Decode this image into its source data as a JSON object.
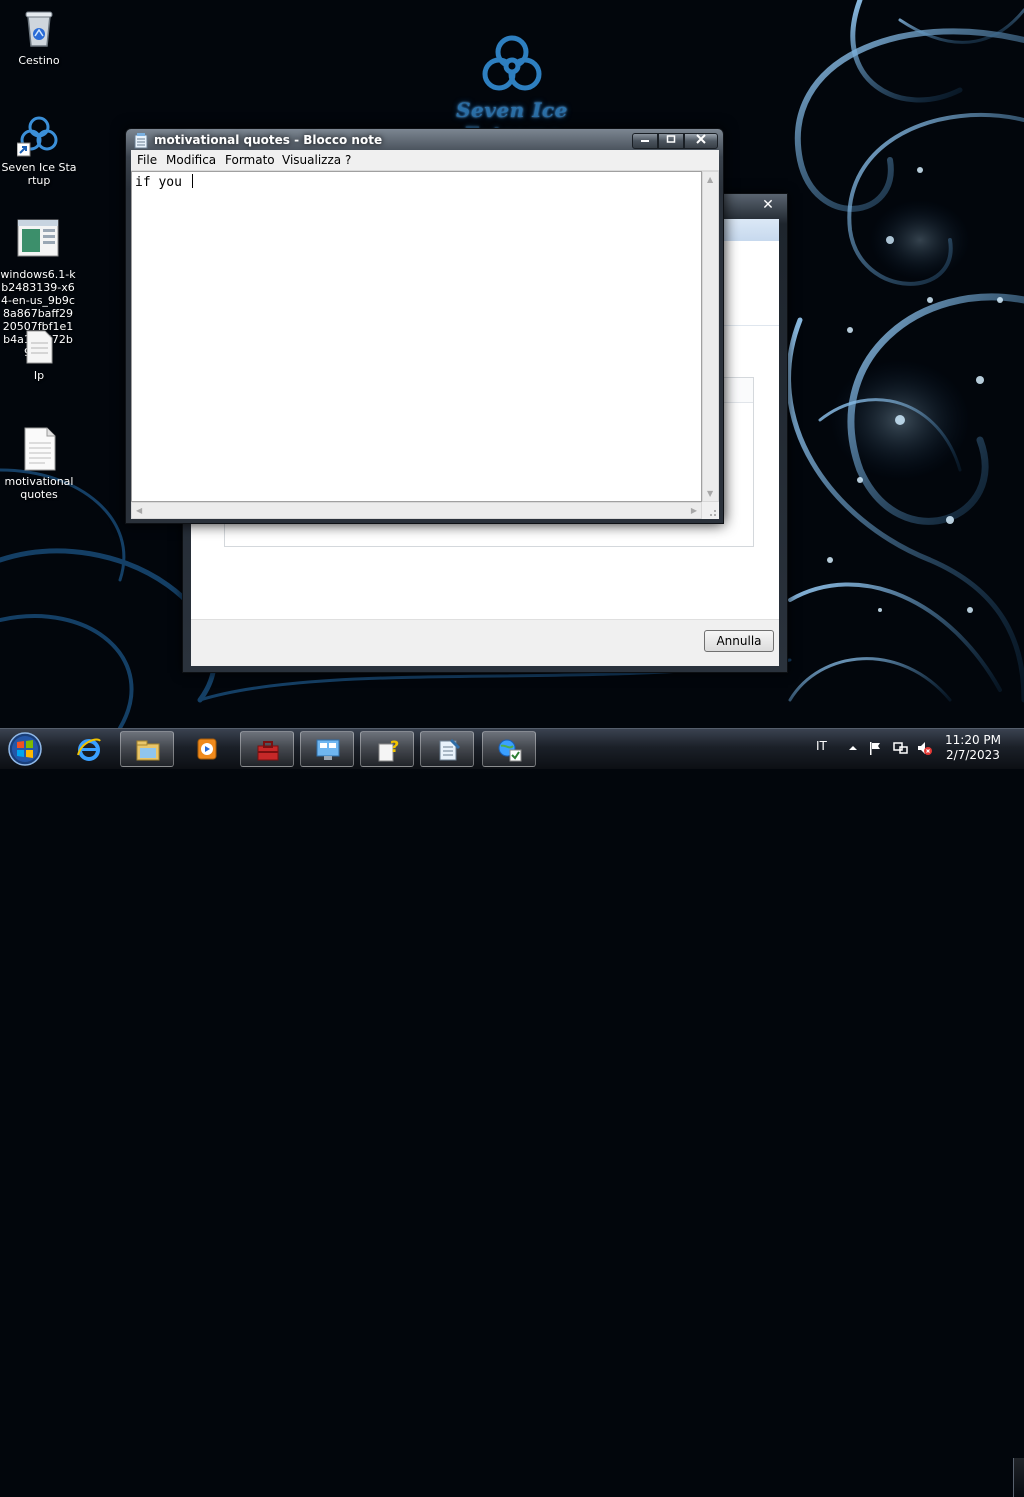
{
  "wallpaper": {
    "logo_text": "Seven Ice Extreme"
  },
  "desktop": {
    "icons": [
      {
        "label": "Cestino",
        "icon": "recycle-bin-icon"
      },
      {
        "label": "Seven Ice Startup",
        "icon": "biohazard-shortcut-icon"
      },
      {
        "label": "windows6.1-kb2483139-x64-en-us_9b9c8a867baff2920507fbf1e1b4a158572b9b87",
        "icon": "update-file-icon"
      },
      {
        "label": "Ip",
        "icon": "text-file-icon"
      },
      {
        "label": "motivational quotes",
        "icon": "text-file-icon"
      }
    ]
  },
  "notepad": {
    "title": "motivational quotes - Blocco note",
    "menu": [
      "File",
      "Modifica",
      "Formato",
      "Visualizza",
      "?"
    ],
    "content": "if you "
  },
  "background_dialog": {
    "cancel_label": "Annulla"
  },
  "taskbar": {
    "buttons": [
      {
        "icon": "start-orb-icon"
      },
      {
        "icon": "internet-explorer-icon"
      },
      {
        "icon": "file-explorer-icon",
        "active": true
      },
      {
        "icon": "media-player-icon"
      },
      {
        "icon": "toolbox-icon"
      },
      {
        "icon": "control-panel-icon"
      },
      {
        "icon": "help-document-icon"
      },
      {
        "icon": "notepad-icon",
        "active": true
      },
      {
        "icon": "globe-checklist-icon"
      }
    ],
    "language": "IT",
    "time": "11:20 PM",
    "date": "2/7/2023"
  },
  "colors": {
    "wallpaper_bg": "#02060c",
    "accent_blue": "#2b6fa6",
    "taskbar": "#1b2028"
  }
}
